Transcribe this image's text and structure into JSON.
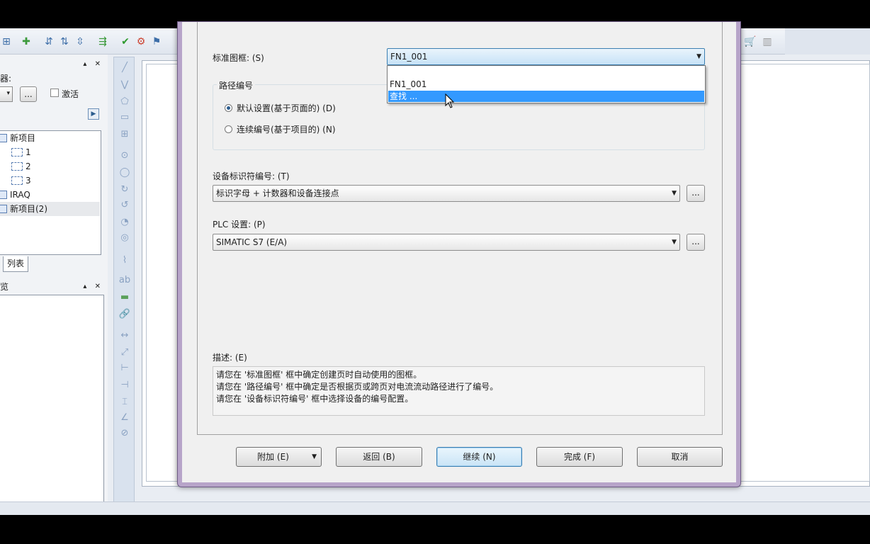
{
  "left_panel": {
    "filter_label": "器:",
    "activate_label": "激活",
    "ellipsis": "...",
    "tree": [
      {
        "label": "新项目",
        "type": "project"
      },
      {
        "label": "1",
        "type": "page"
      },
      {
        "label": "2",
        "type": "page"
      },
      {
        "label": "3",
        "type": "page"
      },
      {
        "label": "IRAQ",
        "type": "project"
      },
      {
        "label": "新项目(2)",
        "type": "project",
        "selected": true
      }
    ],
    "list_tab": "列表",
    "preview_title": "预览"
  },
  "dialog": {
    "template_label": "标准图框: (S)",
    "template_value": "FN1_001",
    "dropdown_options": [
      {
        "label": "FN1_001",
        "highlighted": false
      },
      {
        "label": "查找 ...",
        "highlighted": true
      }
    ],
    "path_group_title": "路径编号",
    "path_options": [
      {
        "label": "默认设置(基于页面的) (D)",
        "selected": true
      },
      {
        "label": "连续编号(基于项目的) (N)",
        "selected": false
      }
    ],
    "device_label": "设备标识符编号: (T)",
    "device_value": "标识字母 + 计数器和设备连接点",
    "plc_label": "PLC 设置: (P)",
    "plc_value": "SIMATIC S7 (E/A)",
    "ellipsis": "...",
    "description_label": "描述: (E)",
    "description_lines": [
      "请您在 '标准图框' 框中确定创建页时自动使用的图框。",
      "请您在 '路径编号' 框中确定是否根据页或跨页对电流流动路径进行了编号。",
      "请您在 '设备标识符编号' 框中选择设备的编号配置。"
    ],
    "buttons": {
      "attach": "附加 (E)",
      "back": "返回 (B)",
      "next": "继续 (N)",
      "finish": "完成 (F)",
      "cancel": "取消"
    }
  },
  "colors": {
    "selection": "#3399ff",
    "dialog_frame": "#b7a4c9",
    "default_button": "#3c7fb1"
  }
}
